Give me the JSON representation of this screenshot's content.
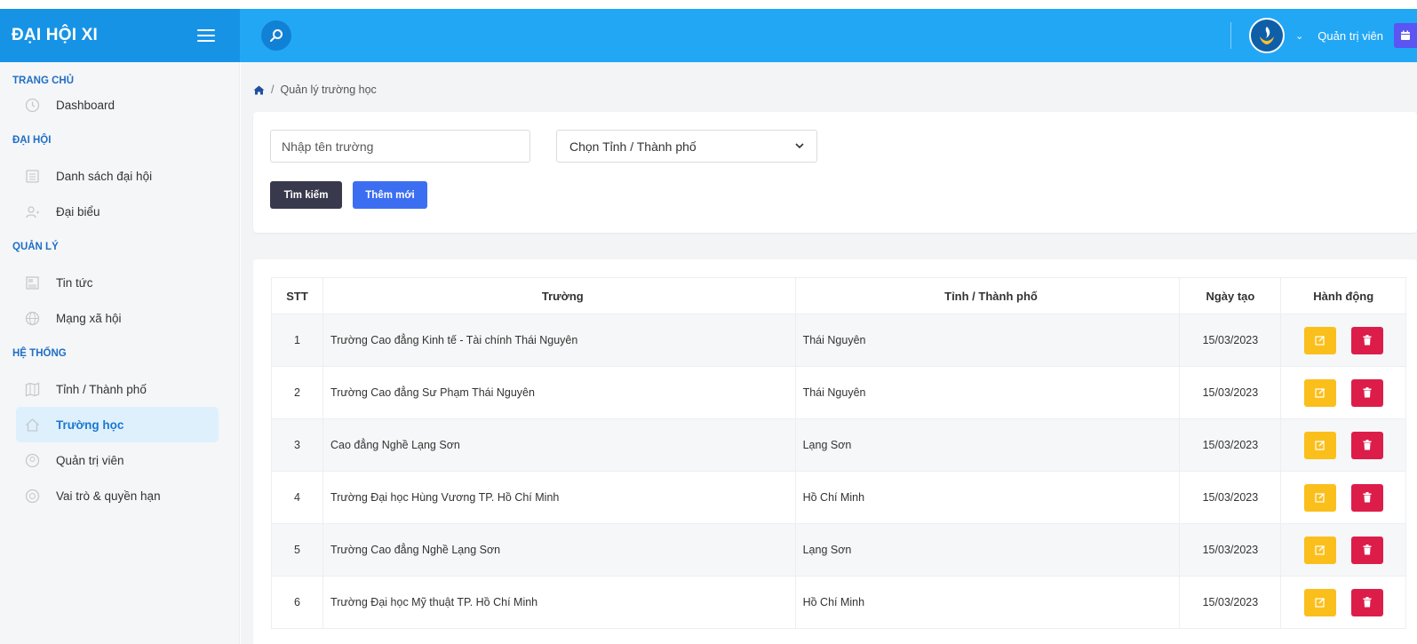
{
  "header": {
    "brand": "ĐẠI HỘI XI",
    "user_name": "Quản trị viên",
    "accent": "#22a7f5"
  },
  "sidebar": {
    "sections": [
      {
        "title": "TRANG CHỦ",
        "items": [
          {
            "label": "Dashboard",
            "icon": "clock-icon"
          }
        ]
      },
      {
        "title": "ĐẠI HỘI",
        "items": [
          {
            "label": "Danh sách đại hội",
            "icon": "list-icon"
          },
          {
            "label": "Đại biểu",
            "icon": "user-plus-icon"
          }
        ]
      },
      {
        "title": "QUẢN LÝ",
        "items": [
          {
            "label": "Tin tức",
            "icon": "news-icon"
          },
          {
            "label": "Mạng xã hội",
            "icon": "globe-icon"
          }
        ]
      },
      {
        "title": "HỆ THỐNG",
        "items": [
          {
            "label": "Tỉnh / Thành phố",
            "icon": "map-icon"
          },
          {
            "label": "Trường học",
            "icon": "home-icon",
            "active": true
          },
          {
            "label": "Quản trị viên",
            "icon": "admin-icon"
          },
          {
            "label": "Vai trò & quyền hạn",
            "icon": "role-icon"
          }
        ]
      }
    ]
  },
  "breadcrumb": {
    "current": "Quản lý trường học"
  },
  "filters": {
    "school_placeholder": "Nhập tên trường",
    "province_selected": "Chọn Tỉnh / Thành phố",
    "search_label": "Tìm kiếm",
    "add_label": "Thêm mới"
  },
  "table": {
    "columns": [
      "STT",
      "Trường",
      "Tỉnh / Thành phố",
      "Ngày tạo",
      "Hành động"
    ],
    "rows": [
      {
        "stt": "1",
        "name": "Trường Cao đẳng Kinh tế - Tài chính Thái Nguyên",
        "province": "Thái Nguyên",
        "date": "15/03/2023"
      },
      {
        "stt": "2",
        "name": "Trường Cao đẳng Sư Phạm Thái Nguyên",
        "province": "Thái Nguyên",
        "date": "15/03/2023"
      },
      {
        "stt": "3",
        "name": "Cao đẳng Nghề Lạng Sơn",
        "province": "Lạng Sơn",
        "date": "15/03/2023"
      },
      {
        "stt": "4",
        "name": "Trường Đại học Hùng Vương TP. Hồ Chí Minh",
        "province": "Hồ Chí Minh",
        "date": "15/03/2023"
      },
      {
        "stt": "5",
        "name": "Trường Cao đẳng Nghề Lạng Sơn",
        "province": "Lạng Sơn",
        "date": "15/03/2023"
      },
      {
        "stt": "6",
        "name": "Trường Đại học Mỹ thuật TP. Hồ Chí Minh",
        "province": "Hồ Chí Minh",
        "date": "15/03/2023"
      }
    ]
  }
}
